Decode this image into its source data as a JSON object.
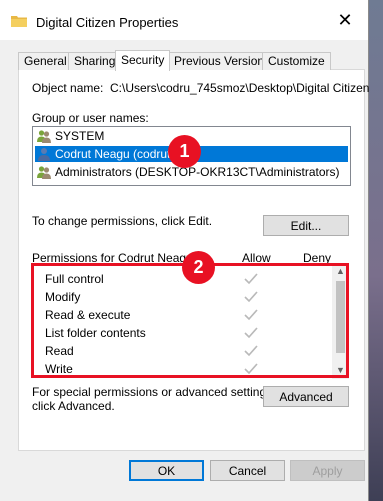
{
  "window": {
    "title": "Digital Citizen Properties",
    "close_glyph": "✕"
  },
  "tabs": [
    {
      "label": "General"
    },
    {
      "label": "Sharing"
    },
    {
      "label": "Security",
      "active": true
    },
    {
      "label": "Previous Versions"
    },
    {
      "label": "Customize"
    }
  ],
  "security": {
    "object_name_label": "Object name:",
    "object_name_value": "C:\\Users\\codru_745smoz\\Desktop\\Digital Citizen",
    "groups_label": "Group or user names:",
    "users": [
      {
        "label": "SYSTEM",
        "icon": "group-users-icon"
      },
      {
        "label": "Codrut Neagu (codrut",
        "icon": "user-icon",
        "selected": true
      },
      {
        "label": "Administrators (DESKTOP-OKR13CT\\Administrators)",
        "icon": "group-users-icon"
      }
    ],
    "change_hint": "To change permissions, click Edit.",
    "edit_button": "Edit...",
    "permissions_label": "Permissions for Codrut Neagu",
    "allow_header": "Allow",
    "deny_header": "Deny",
    "permissions": [
      {
        "name": "Full control",
        "allow": true,
        "deny": false
      },
      {
        "name": "Modify",
        "allow": true,
        "deny": false
      },
      {
        "name": "Read & execute",
        "allow": true,
        "deny": false
      },
      {
        "name": "List folder contents",
        "allow": true,
        "deny": false
      },
      {
        "name": "Read",
        "allow": true,
        "deny": false
      },
      {
        "name": "Write",
        "allow": true,
        "deny": false
      }
    ],
    "special_hint_line1": "For special permissions or advanced settings,",
    "special_hint_line2": "click Advanced.",
    "advanced_button": "Advanced"
  },
  "footer": {
    "ok": "OK",
    "cancel": "Cancel",
    "apply": "Apply"
  },
  "annotations": {
    "badge1": "1",
    "badge2": "2",
    "highlight_color": "#e81123"
  },
  "colors": {
    "selection": "#0078d7",
    "check": "#b9b9b9"
  }
}
